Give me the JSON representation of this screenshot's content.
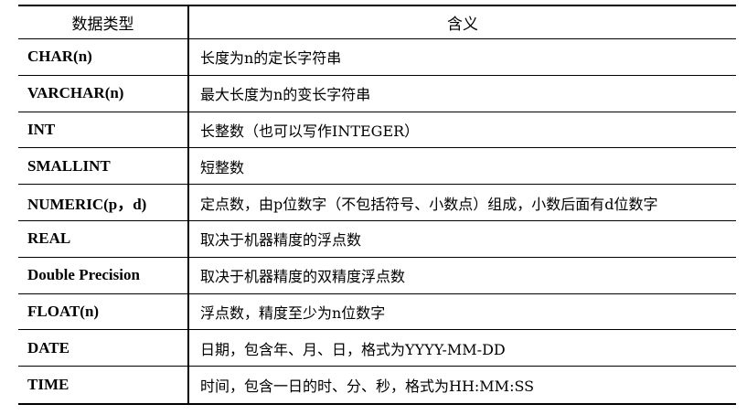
{
  "table": {
    "headers": {
      "type": "数据类型",
      "meaning": "含义"
    },
    "rows": [
      {
        "type": "CHAR(n)",
        "meaning": "长度为n的定长字符串"
      },
      {
        "type": "VARCHAR(n)",
        "meaning": "最大长度为n的变长字符串"
      },
      {
        "type": "INT",
        "meaning": "长整数（也可以写作INTEGER）"
      },
      {
        "type": "SMALLINT",
        "meaning": "短整数"
      },
      {
        "type": "NUMERIC(p，d)",
        "meaning": "定点数，由p位数字（不包括符号、小数点）组成，小数后面有d位数字"
      },
      {
        "type": "REAL",
        "meaning": "取决于机器精度的浮点数"
      },
      {
        "type": "Double Precision",
        "meaning": "取决于机器精度的双精度浮点数"
      },
      {
        "type": "FLOAT(n)",
        "meaning": "浮点数，精度至少为n位数字"
      },
      {
        "type": "DATE",
        "meaning": "日期，包含年、月、日，格式为YYYY-MM-DD"
      },
      {
        "type": "TIME",
        "meaning": "时间，包含一日的时、分、秒，格式为HH:MM:SS"
      }
    ]
  }
}
